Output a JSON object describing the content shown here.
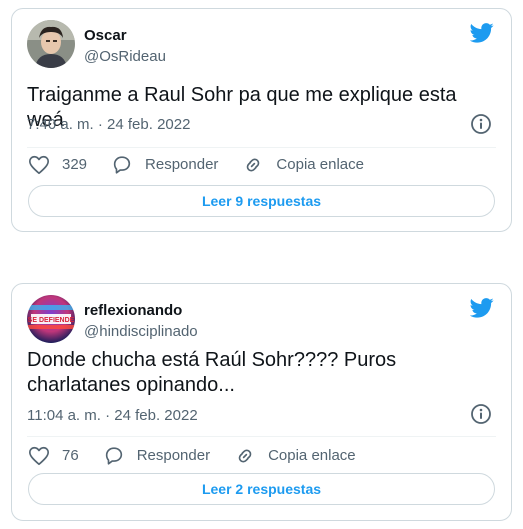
{
  "colors": {
    "twitter_blue": "#1d9bf0",
    "text_primary": "#0f1419",
    "text_secondary": "#536471",
    "border": "#cfd9de"
  },
  "icons": {
    "brand": "twitter-bird-icon",
    "info": "info-icon",
    "like": "heart-icon",
    "reply": "speech-bubble-icon",
    "copy_link": "link-icon"
  },
  "tweets": [
    {
      "author_name": "Oscar",
      "author_handle": "@OsRideau",
      "text": "Traiganme a Raul Sohr pa que me explique esta weá",
      "timestamp": "7:40 a. m. · 24 feb. 2022",
      "likes": "329",
      "reply_label": "Responder",
      "copy_link_label": "Copia enlace",
      "read_replies_label": "Leer 9 respuestas"
    },
    {
      "author_name": "reflexionando",
      "author_handle": "@hindisciplinado",
      "avatar_text": "SE DEFIENDE",
      "text": "Donde chucha está Raúl Sohr???? Puros charlatanes opinando...",
      "timestamp": "11:04 a. m. · 24 feb. 2022",
      "likes": "76",
      "reply_label": "Responder",
      "copy_link_label": "Copia enlace",
      "read_replies_label": "Leer 2 respuestas"
    }
  ]
}
